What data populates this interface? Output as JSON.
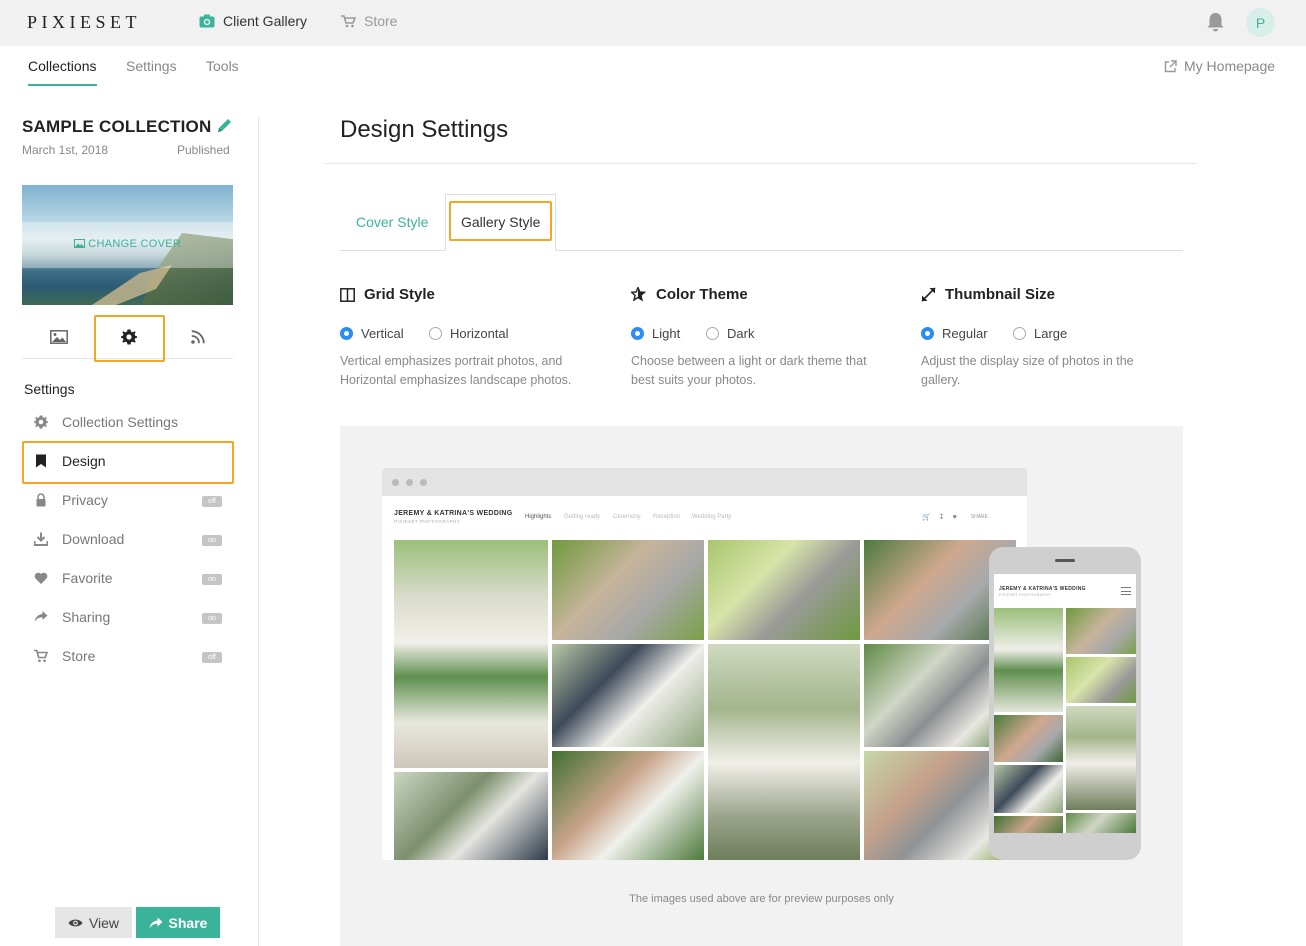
{
  "topbar": {
    "logo": "PIXIESET",
    "client_gallery": "Client Gallery",
    "store": "Store",
    "avatar_initial": "P"
  },
  "subnav": {
    "tabs": [
      "Collections",
      "Settings",
      "Tools"
    ],
    "active_tab": "Collections",
    "homepage_link": "My Homepage"
  },
  "collection": {
    "title": "SAMPLE COLLECTION",
    "date": "March 1st, 2018",
    "status": "Published",
    "change_cover": "CHANGE COVER"
  },
  "sidebar": {
    "heading": "Settings",
    "items": [
      {
        "label": "Collection Settings",
        "icon": "gear-icon",
        "badge": null
      },
      {
        "label": "Design",
        "icon": "bookmark-icon",
        "badge": null
      },
      {
        "label": "Privacy",
        "icon": "lock-icon",
        "badge": "off"
      },
      {
        "label": "Download",
        "icon": "download-icon",
        "badge": "on"
      },
      {
        "label": "Favorite",
        "icon": "heart-icon",
        "badge": "on"
      },
      {
        "label": "Sharing",
        "icon": "share-arrow-icon",
        "badge": "on"
      },
      {
        "label": "Store",
        "icon": "cart-icon",
        "badge": "off"
      }
    ],
    "active_item": "Design",
    "view_button": "View",
    "share_button": "Share"
  },
  "main": {
    "title": "Design Settings",
    "tabs": [
      "Cover Style",
      "Gallery Style"
    ],
    "active_tab": "Gallery Style",
    "options": [
      {
        "heading": "Grid Style",
        "icon": "columns-icon",
        "choices": [
          "Vertical",
          "Horizontal"
        ],
        "selected": "Vertical",
        "description": "Vertical emphasizes portrait photos, and Horizontal emphasizes landscape photos."
      },
      {
        "heading": "Color Theme",
        "icon": "star-edit-icon",
        "choices": [
          "Light",
          "Dark"
        ],
        "selected": "Light",
        "description": "Choose between a light or dark theme that best suits your photos."
      },
      {
        "heading": "Thumbnail Size",
        "icon": "expand-icon",
        "choices": [
          "Regular",
          "Large"
        ],
        "selected": "Regular",
        "description": "Adjust the display size of photos in the gallery."
      }
    ],
    "preview": {
      "gallery_title": "JEREMY & KATRINA'S WEDDING",
      "gallery_subtitle": "PIXIESET PHOTOGRAPHY",
      "nav": [
        "Highlights",
        "Getting ready",
        "Ceremony",
        "Reception",
        "Wedding Party"
      ],
      "share_label": "SHARE",
      "footnote": "The images used above are for preview purposes only"
    }
  },
  "colors": {
    "accent": "#3bb39a",
    "highlight": "#f5a623",
    "radio_selected": "#2d8cf0"
  }
}
